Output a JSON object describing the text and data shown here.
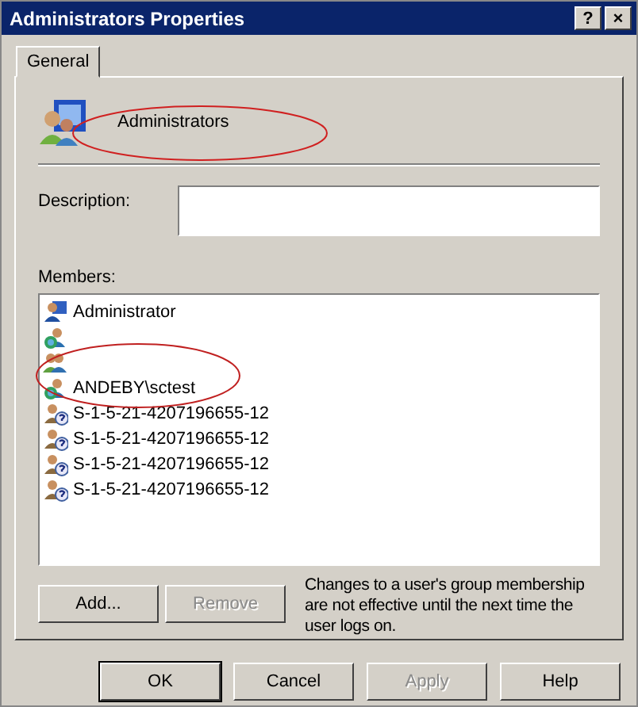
{
  "window": {
    "title": "Administrators Properties",
    "title_buttons": [
      "?",
      "×"
    ]
  },
  "tabs": [
    {
      "label": "General",
      "selected": true
    }
  ],
  "group_name": "Administrators",
  "description": {
    "label": "Description:"
  },
  "members": {
    "label": "Members:",
    "items": [
      {
        "kind": "user",
        "name": "Administrator"
      },
      {
        "kind": "domain"
      },
      {
        "kind": "group"
      },
      {
        "kind": "domain",
        "name": "ANDEBY\\sctest"
      },
      {
        "kind": "unknown",
        "name": "S-1-5-21-4207196655-12"
      },
      {
        "kind": "unknown",
        "name": "S-1-5-21-4207196655-12"
      },
      {
        "kind": "unknown",
        "name": "S-1-5-21-4207196655-12"
      },
      {
        "kind": "unknown",
        "name": "S-1-5-21-4207196655-12"
      }
    ]
  },
  "member_buttons": [
    {
      "label": "Add...",
      "disabled": false
    },
    {
      "label": "Remove",
      "disabled": true
    }
  ],
  "note": "Changes to a user's group membership are not effective until the next time the user logs on.",
  "dialog_buttons": [
    {
      "label": "OK",
      "disabled": false,
      "default": true
    },
    {
      "label": "Cancel",
      "disabled": false,
      "default": false
    },
    {
      "label": "Apply",
      "disabled": true,
      "default": false
    },
    {
      "label": "Help",
      "disabled": false,
      "default": false
    }
  ]
}
